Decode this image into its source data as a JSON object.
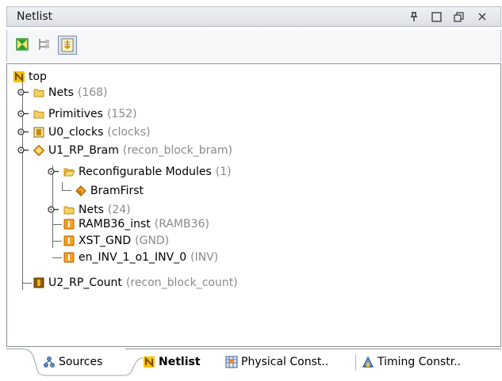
{
  "panel": {
    "title": "Netlist",
    "controls": {
      "pin": "ꟼ",
      "maximize": "□",
      "restore": "⧉",
      "close": "×"
    }
  },
  "toolbar": {
    "buttons": [
      {
        "icon": "collapse-all-icon",
        "selected": false
      },
      {
        "icon": "expand-hierarchy-icon",
        "selected": false
      },
      {
        "icon": "show-selection-icon",
        "selected": true
      }
    ]
  },
  "tree": {
    "root": {
      "name": "top"
    },
    "nodes": [
      {
        "name": "Nets",
        "meta": "(168)"
      },
      {
        "name": "Primitives",
        "meta": "(152)"
      },
      {
        "name": "U0_clocks",
        "meta": "(clocks)"
      },
      {
        "name": "U1_RP_Bram",
        "meta": "(recon_block_bram)"
      },
      {
        "name": "Reconfigurable Modules",
        "meta": "(1)"
      },
      {
        "name": "BramFirst",
        "meta": ""
      },
      {
        "name": "Nets",
        "meta": "(24)"
      },
      {
        "name": "RAMB36_inst",
        "meta": "(RAMB36)"
      },
      {
        "name": "XST_GND",
        "meta": "(GND)"
      },
      {
        "name": "en_INV_1_o1_INV_0",
        "meta": "(INV)"
      },
      {
        "name": "U2_RP_Count",
        "meta": "(recon_block_count)"
      }
    ]
  },
  "tabs": [
    {
      "label": "Sources",
      "active": false
    },
    {
      "label": "Netlist",
      "active": true
    },
    {
      "label": "Physical Const..",
      "active": false
    },
    {
      "label": "Timing Constr..",
      "active": false
    }
  ],
  "colors": {
    "folder": "#f0c040",
    "instance": "#f09a20",
    "diamond": "#f0b020",
    "netlist_n": "#e0a000"
  }
}
